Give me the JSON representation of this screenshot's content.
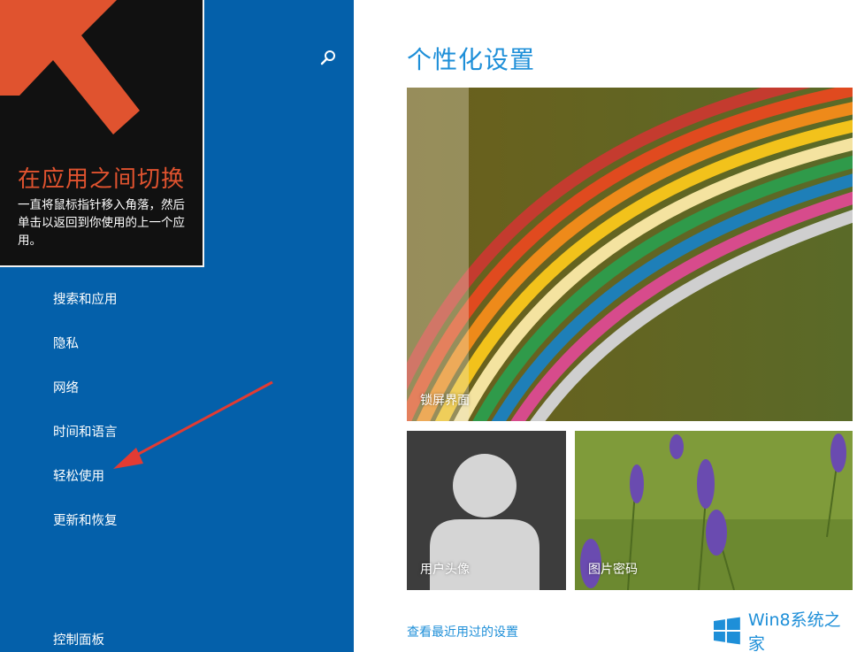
{
  "tip": {
    "title": "在应用之间切换",
    "body": "一直将鼠标指针移入角落，然后单击以返回到你使用的上一个应用。"
  },
  "search": {
    "icon": "search-icon"
  },
  "nav": {
    "items": [
      {
        "label": "搜索和应用"
      },
      {
        "label": "隐私"
      },
      {
        "label": "网络"
      },
      {
        "label": "时间和语言"
      },
      {
        "label": "轻松使用"
      },
      {
        "label": "更新和恢复"
      }
    ],
    "control_panel": "控制面板"
  },
  "main": {
    "title": "个性化设置",
    "tiles": {
      "lock_screen": "锁屏界面",
      "account_picture": "用户头像",
      "picture_password": "图片密码"
    },
    "recent_link": "查看最近用过的设置"
  },
  "brand": {
    "text": "Win8系统之家"
  },
  "colors": {
    "left_panel": "#0460aa",
    "accent": "#1e8fd8",
    "tip_title": "#e0532f",
    "annotation_arrow": "#e23b33"
  }
}
